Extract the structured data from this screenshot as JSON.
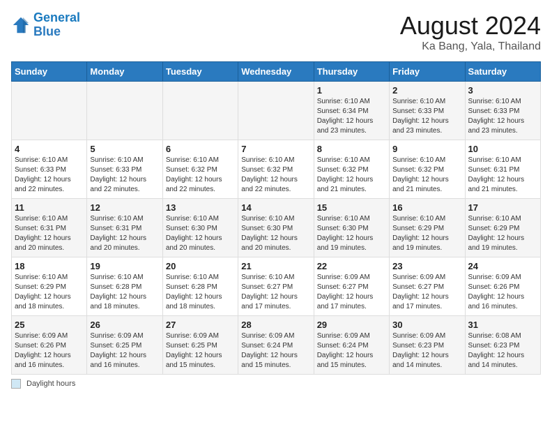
{
  "logo": {
    "line1": "General",
    "line2": "Blue"
  },
  "title": "August 2024",
  "subtitle": "Ka Bang, Yala, Thailand",
  "days_header": [
    "Sunday",
    "Monday",
    "Tuesday",
    "Wednesday",
    "Thursday",
    "Friday",
    "Saturday"
  ],
  "footer_label": "Daylight hours",
  "weeks": [
    [
      {
        "day": "",
        "info": ""
      },
      {
        "day": "",
        "info": ""
      },
      {
        "day": "",
        "info": ""
      },
      {
        "day": "",
        "info": ""
      },
      {
        "day": "1",
        "info": "Sunrise: 6:10 AM\nSunset: 6:34 PM\nDaylight: 12 hours and 23 minutes."
      },
      {
        "day": "2",
        "info": "Sunrise: 6:10 AM\nSunset: 6:33 PM\nDaylight: 12 hours and 23 minutes."
      },
      {
        "day": "3",
        "info": "Sunrise: 6:10 AM\nSunset: 6:33 PM\nDaylight: 12 hours and 23 minutes."
      }
    ],
    [
      {
        "day": "4",
        "info": "Sunrise: 6:10 AM\nSunset: 6:33 PM\nDaylight: 12 hours and 22 minutes."
      },
      {
        "day": "5",
        "info": "Sunrise: 6:10 AM\nSunset: 6:33 PM\nDaylight: 12 hours and 22 minutes."
      },
      {
        "day": "6",
        "info": "Sunrise: 6:10 AM\nSunset: 6:32 PM\nDaylight: 12 hours and 22 minutes."
      },
      {
        "day": "7",
        "info": "Sunrise: 6:10 AM\nSunset: 6:32 PM\nDaylight: 12 hours and 22 minutes."
      },
      {
        "day": "8",
        "info": "Sunrise: 6:10 AM\nSunset: 6:32 PM\nDaylight: 12 hours and 21 minutes."
      },
      {
        "day": "9",
        "info": "Sunrise: 6:10 AM\nSunset: 6:32 PM\nDaylight: 12 hours and 21 minutes."
      },
      {
        "day": "10",
        "info": "Sunrise: 6:10 AM\nSunset: 6:31 PM\nDaylight: 12 hours and 21 minutes."
      }
    ],
    [
      {
        "day": "11",
        "info": "Sunrise: 6:10 AM\nSunset: 6:31 PM\nDaylight: 12 hours and 20 minutes."
      },
      {
        "day": "12",
        "info": "Sunrise: 6:10 AM\nSunset: 6:31 PM\nDaylight: 12 hours and 20 minutes."
      },
      {
        "day": "13",
        "info": "Sunrise: 6:10 AM\nSunset: 6:30 PM\nDaylight: 12 hours and 20 minutes."
      },
      {
        "day": "14",
        "info": "Sunrise: 6:10 AM\nSunset: 6:30 PM\nDaylight: 12 hours and 20 minutes."
      },
      {
        "day": "15",
        "info": "Sunrise: 6:10 AM\nSunset: 6:30 PM\nDaylight: 12 hours and 19 minutes."
      },
      {
        "day": "16",
        "info": "Sunrise: 6:10 AM\nSunset: 6:29 PM\nDaylight: 12 hours and 19 minutes."
      },
      {
        "day": "17",
        "info": "Sunrise: 6:10 AM\nSunset: 6:29 PM\nDaylight: 12 hours and 19 minutes."
      }
    ],
    [
      {
        "day": "18",
        "info": "Sunrise: 6:10 AM\nSunset: 6:29 PM\nDaylight: 12 hours and 18 minutes."
      },
      {
        "day": "19",
        "info": "Sunrise: 6:10 AM\nSunset: 6:28 PM\nDaylight: 12 hours and 18 minutes."
      },
      {
        "day": "20",
        "info": "Sunrise: 6:10 AM\nSunset: 6:28 PM\nDaylight: 12 hours and 18 minutes."
      },
      {
        "day": "21",
        "info": "Sunrise: 6:10 AM\nSunset: 6:27 PM\nDaylight: 12 hours and 17 minutes."
      },
      {
        "day": "22",
        "info": "Sunrise: 6:09 AM\nSunset: 6:27 PM\nDaylight: 12 hours and 17 minutes."
      },
      {
        "day": "23",
        "info": "Sunrise: 6:09 AM\nSunset: 6:27 PM\nDaylight: 12 hours and 17 minutes."
      },
      {
        "day": "24",
        "info": "Sunrise: 6:09 AM\nSunset: 6:26 PM\nDaylight: 12 hours and 16 minutes."
      }
    ],
    [
      {
        "day": "25",
        "info": "Sunrise: 6:09 AM\nSunset: 6:26 PM\nDaylight: 12 hours and 16 minutes."
      },
      {
        "day": "26",
        "info": "Sunrise: 6:09 AM\nSunset: 6:25 PM\nDaylight: 12 hours and 16 minutes."
      },
      {
        "day": "27",
        "info": "Sunrise: 6:09 AM\nSunset: 6:25 PM\nDaylight: 12 hours and 15 minutes."
      },
      {
        "day": "28",
        "info": "Sunrise: 6:09 AM\nSunset: 6:24 PM\nDaylight: 12 hours and 15 minutes."
      },
      {
        "day": "29",
        "info": "Sunrise: 6:09 AM\nSunset: 6:24 PM\nDaylight: 12 hours and 15 minutes."
      },
      {
        "day": "30",
        "info": "Sunrise: 6:09 AM\nSunset: 6:23 PM\nDaylight: 12 hours and 14 minutes."
      },
      {
        "day": "31",
        "info": "Sunrise: 6:08 AM\nSunset: 6:23 PM\nDaylight: 12 hours and 14 minutes."
      }
    ]
  ]
}
